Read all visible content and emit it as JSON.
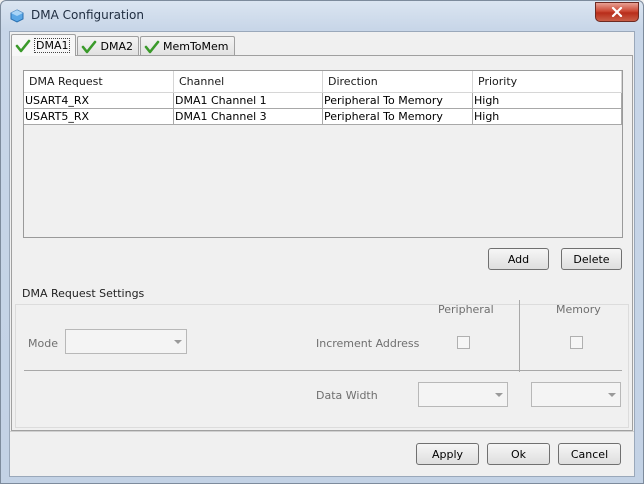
{
  "window": {
    "title": "DMA Configuration",
    "app_icon": "cube-icon",
    "close_icon": "close-icon"
  },
  "tabs": [
    {
      "label": "DMA1",
      "icon": "check-icon",
      "active": true
    },
    {
      "label": "DMA2",
      "icon": "check-icon",
      "active": false
    },
    {
      "label": "MemToMem",
      "icon": "check-icon",
      "active": false
    }
  ],
  "table": {
    "headers": [
      "DMA Request",
      "Channel",
      "Direction",
      "Priority"
    ],
    "rows": [
      [
        "USART4_RX",
        "DMA1 Channel 1",
        "Peripheral To Memory",
        "High"
      ],
      [
        "USART5_RX",
        "DMA1 Channel 3",
        "Peripheral To Memory",
        "High"
      ]
    ]
  },
  "table_buttons": {
    "add": "Add",
    "delete": "Delete"
  },
  "settings": {
    "group_title": "DMA Request Settings",
    "mode_label": "Mode",
    "mode_value": "",
    "peripheral_header": "Peripheral",
    "memory_header": "Memory",
    "increment_label": "Increment Address",
    "increment_peripheral": false,
    "increment_memory": false,
    "data_width_label": "Data Width",
    "data_width_peripheral": "",
    "data_width_memory": ""
  },
  "footer": {
    "apply": "Apply",
    "ok": "Ok",
    "cancel": "Cancel"
  },
  "colors": {
    "check_green": "#3a9a2a",
    "close_red": "#c4432e"
  }
}
